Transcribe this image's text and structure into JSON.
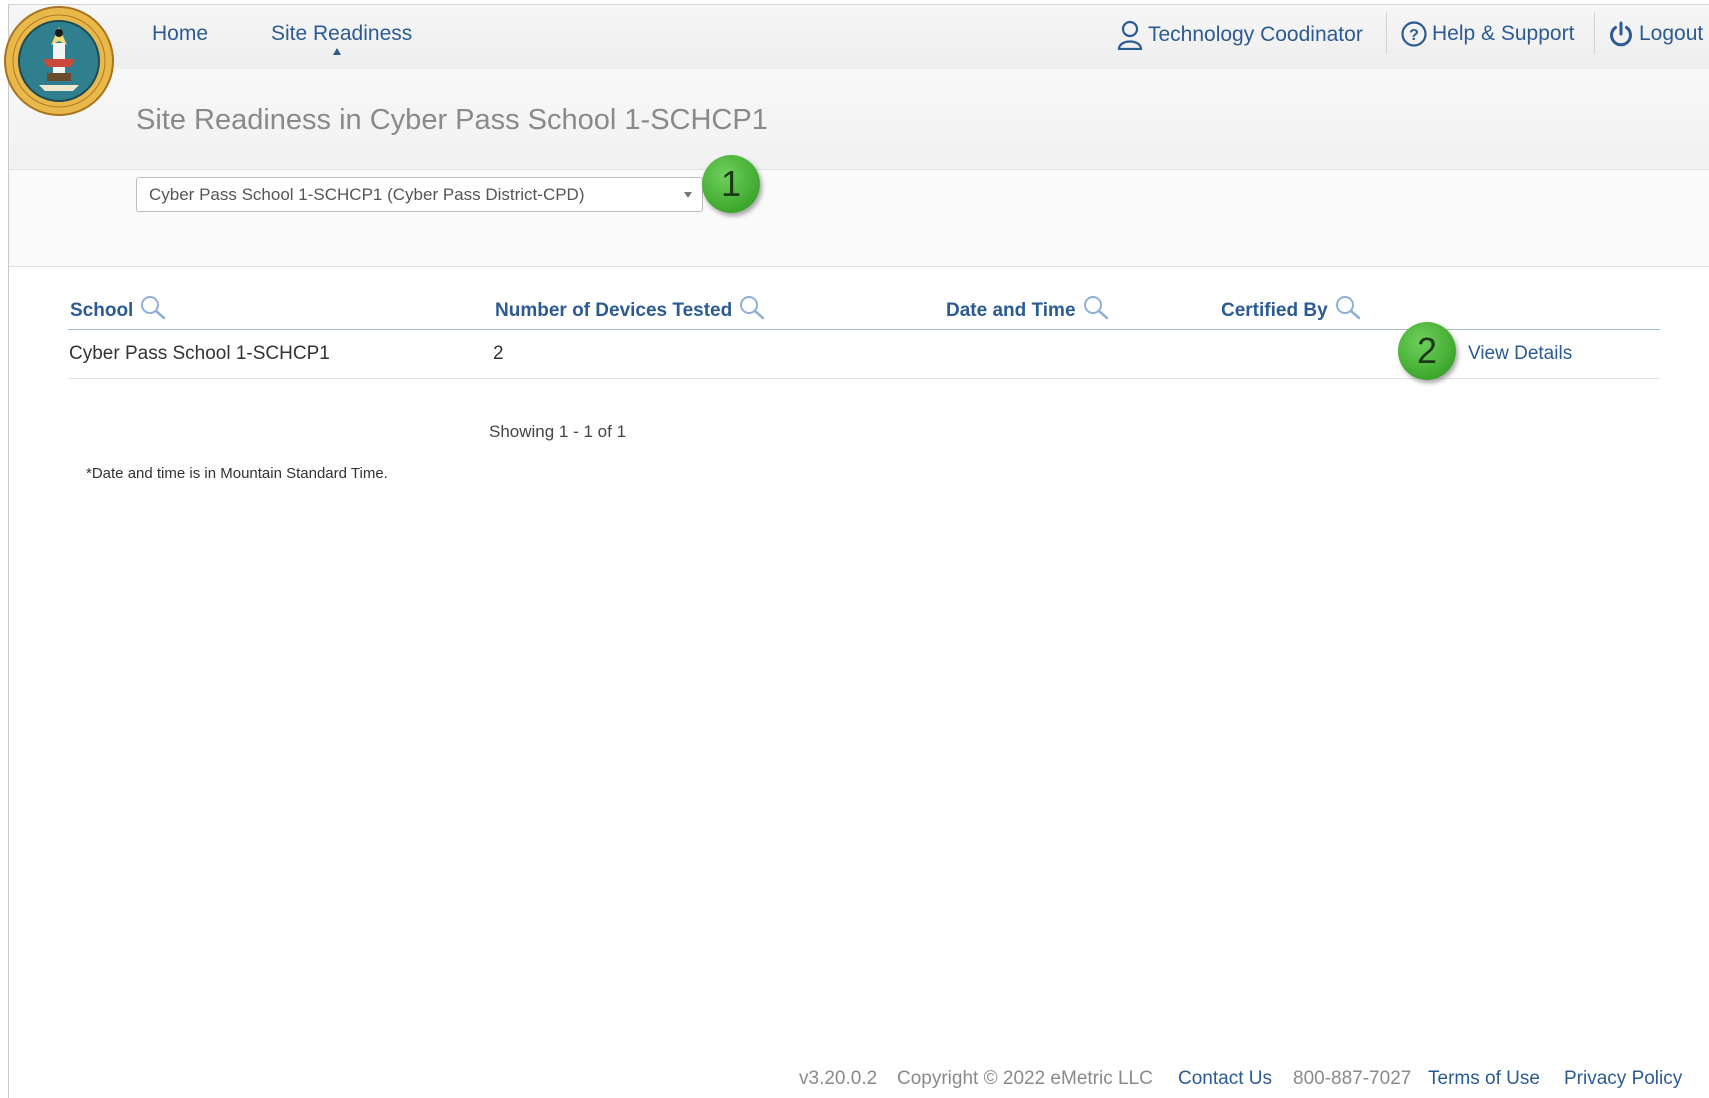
{
  "nav": {
    "home": "Home",
    "site_readiness": "Site Readiness"
  },
  "user_menu": {
    "role": "Technology Coodinator",
    "help": "Help & Support",
    "logout": "Logout"
  },
  "page": {
    "title": "Site Readiness in Cyber Pass School 1-SCHCP1"
  },
  "school_select": {
    "selected": "Cyber Pass School 1-SCHCP1 (Cyber Pass District-CPD)"
  },
  "callouts": {
    "one": "1",
    "two": "2"
  },
  "table": {
    "headers": {
      "school": "School",
      "devices": "Number of Devices Tested",
      "datetime": "Date and Time",
      "certified": "Certified By"
    },
    "rows": [
      {
        "school": "Cyber Pass School 1-SCHCP1",
        "devices": "2",
        "datetime": "",
        "certified": "",
        "action": "View Details"
      }
    ]
  },
  "pagination": {
    "showing": "Showing 1 - 1 of 1"
  },
  "note": "*Date and time is in Mountain Standard Time.",
  "footer": {
    "version": "v3.20.0.2",
    "copyright": "Copyright © 2022 eMetric LLC",
    "contact": "Contact Us",
    "phone": "800-887-7027",
    "terms": "Terms of Use",
    "privacy": "Privacy Policy"
  },
  "colors": {
    "link": "#2c5b93",
    "callout_green": "#3ea82e",
    "title_gray": "#8a8a8a"
  },
  "icons": [
    "bureau-of-indian-education-seal",
    "user-icon",
    "help-circle-icon",
    "power-icon",
    "search-icon",
    "chevron-down-icon"
  ]
}
